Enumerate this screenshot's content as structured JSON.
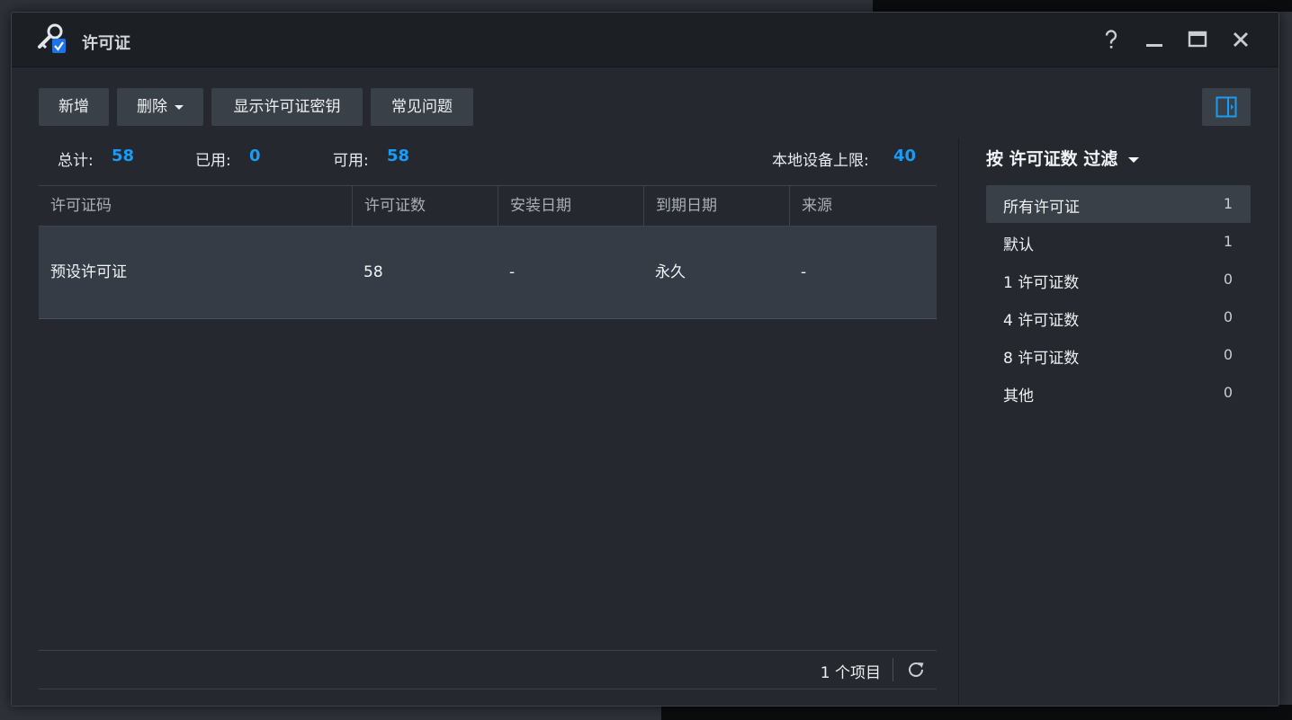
{
  "window": {
    "title": "许可证"
  },
  "toolbar": {
    "add_label": "新增",
    "delete_label": "删除",
    "show_key_label": "显示许可证密钥",
    "faq_label": "常见问题"
  },
  "stats": {
    "total_label": "总计:",
    "total_value": "58",
    "used_label": "已用:",
    "used_value": "0",
    "available_label": "可用:",
    "available_value": "58",
    "limit_label": "本地设备上限:",
    "limit_value": "40"
  },
  "table": {
    "columns": [
      "许可证码",
      "许可证数",
      "安装日期",
      "到期日期",
      "来源"
    ],
    "rows": [
      {
        "code": "预设许可证",
        "count": "58",
        "install_date": "-",
        "expiry_date": "永久",
        "source": "-"
      }
    ]
  },
  "footer": {
    "item_count": "1 个项目"
  },
  "filter": {
    "title": "按 许可证数 过滤",
    "items": [
      {
        "label": "所有许可证",
        "count": "1"
      },
      {
        "label": "默认",
        "count": "1"
      },
      {
        "label": "1 许可证数",
        "count": "0"
      },
      {
        "label": "4 许可证数",
        "count": "0"
      },
      {
        "label": "8 许可证数",
        "count": "0"
      },
      {
        "label": "其他",
        "count": "0"
      }
    ]
  },
  "colors": {
    "accent": "#1a9bf5",
    "selected_row": "#353c45"
  }
}
